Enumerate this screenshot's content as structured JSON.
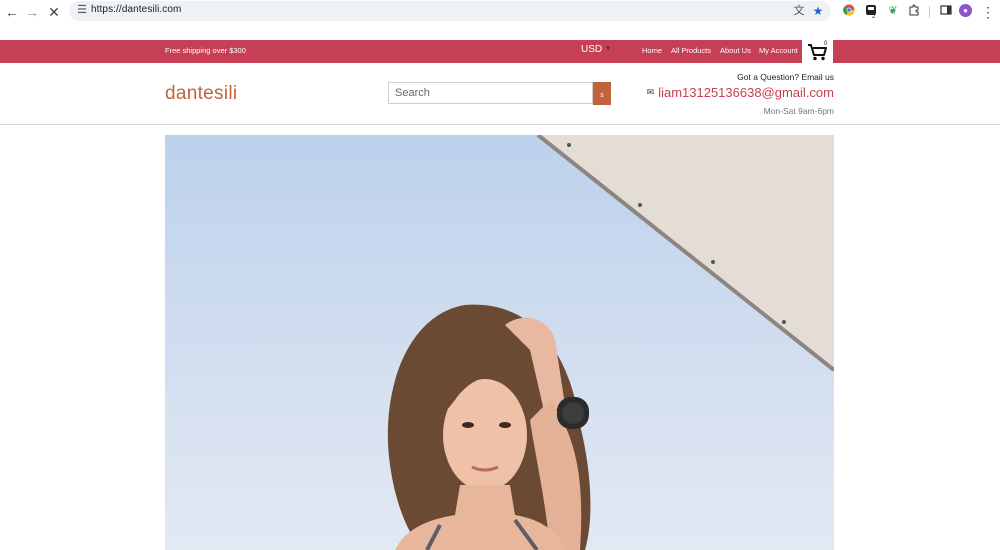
{
  "browser": {
    "url": "https://dantesili.com",
    "extensions": [
      "translate-icon",
      "bookmark-star-icon",
      "chrome-ext-icon",
      "notifications-ext-icon",
      "leaf-ext-icon",
      "puzzle-icon",
      "side-panel-icon"
    ],
    "ext_badge": "2"
  },
  "topbar": {
    "shipping": "Free shipping over $300",
    "currency": "USD",
    "nav": [
      "Home",
      "All Products",
      "About Us",
      "My Account"
    ],
    "cart_count": "0"
  },
  "header": {
    "logo": "dantesili",
    "search_placeholder": "Search",
    "search_button": "s",
    "question": "Got a Question? Email us",
    "email": "liam13125136638@gmail.com",
    "hours": "Mon-Sat 9am-6pm"
  },
  "colors": {
    "accent": "#c63f54",
    "brand": "#c0633d"
  }
}
